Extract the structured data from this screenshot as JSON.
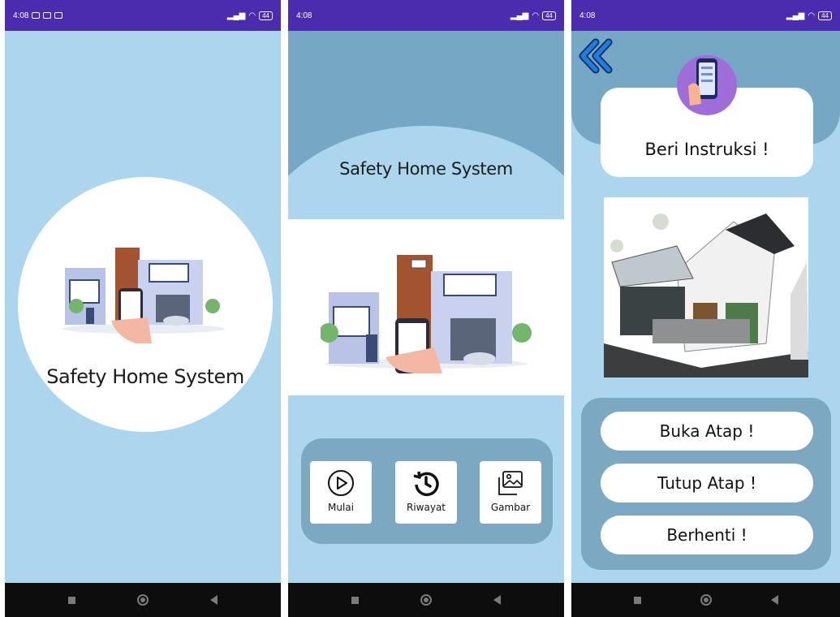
{
  "status_bar": {
    "screen1_time": "4:08",
    "screen2_time": "4:08",
    "screen3_time": "4:08",
    "battery": "44"
  },
  "splash": {
    "title": "Safety Home System"
  },
  "home": {
    "title": "Safety Home System",
    "menu": [
      {
        "label": "Mulai",
        "icon": "play-circle-icon"
      },
      {
        "label": "Riwayat",
        "icon": "history-icon"
      },
      {
        "label": "Gambar",
        "icon": "gallery-icon"
      }
    ]
  },
  "control": {
    "title": "Beri Instruksi !",
    "buttons": [
      {
        "label": "Buka Atap !"
      },
      {
        "label": "Tutup Atap !"
      },
      {
        "label": "Berhenti !"
      }
    ]
  },
  "colors": {
    "status_bar": "#4c2cae",
    "background": "#acd6ee",
    "panel": "#7da8c2",
    "band": "#76a7c4",
    "back_arrow": "#1f7fd8"
  }
}
